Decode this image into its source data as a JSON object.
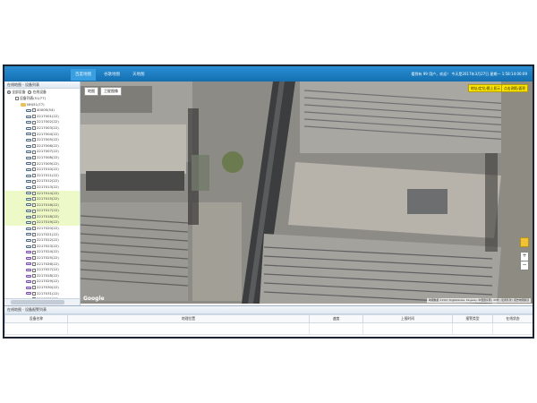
{
  "nav": {
    "tabs": [
      {
        "label": "百度地图"
      },
      {
        "label": "谷歌地图"
      },
      {
        "label": "天地图"
      }
    ]
  },
  "user": {
    "text": "看到有 99 用户，欢迎！    今天是2017年3月27日 星期一  1:58:14:00:09"
  },
  "sidebar": {
    "title": "在线地图 - 设备列表",
    "options": [
      {
        "label": "全部设备",
        "checked": true
      },
      {
        "label": "在线设备",
        "checked": false
      }
    ],
    "tree": [
      {
        "label": "设备列表(51/77)",
        "kind": "root"
      },
      {
        "label": "NH(51/77)",
        "kind": "folder"
      },
      {
        "label": "40000(54)",
        "kind": "device",
        "status": "online"
      },
      {
        "label": "2217001(22)",
        "kind": "device",
        "status": "online"
      },
      {
        "label": "2217002(22)",
        "kind": "device",
        "status": "online"
      },
      {
        "label": "2217003(22)",
        "kind": "device",
        "status": "online"
      },
      {
        "label": "2217004(22)",
        "kind": "device",
        "status": "online"
      },
      {
        "label": "2217005(22)",
        "kind": "device",
        "status": "online"
      },
      {
        "label": "2217006(22)",
        "kind": "device",
        "status": "online"
      },
      {
        "label": "2217007(22)",
        "kind": "device",
        "status": "online"
      },
      {
        "label": "2217008(22)",
        "kind": "device",
        "status": "online"
      },
      {
        "label": "2217009(22)",
        "kind": "device",
        "status": "online"
      },
      {
        "label": "2217010(22)",
        "kind": "device",
        "status": "online"
      },
      {
        "label": "2217011(22)",
        "kind": "device",
        "status": "online"
      },
      {
        "label": "2217012(22)",
        "kind": "device",
        "status": "online"
      },
      {
        "label": "2217013(22)",
        "kind": "device",
        "status": "online"
      },
      {
        "label": "2217014(22)",
        "kind": "device",
        "status": "selected"
      },
      {
        "label": "2217015(22)",
        "kind": "device",
        "status": "selected"
      },
      {
        "label": "2217016(22)",
        "kind": "device",
        "status": "selected"
      },
      {
        "label": "2217017(22)",
        "kind": "device",
        "status": "selected"
      },
      {
        "label": "2217018(22)",
        "kind": "device",
        "status": "selected"
      },
      {
        "label": "2217019(22)",
        "kind": "device",
        "status": "selected"
      },
      {
        "label": "2217020(22)",
        "kind": "device",
        "status": "online"
      },
      {
        "label": "2217021(22)",
        "kind": "device",
        "status": "online"
      },
      {
        "label": "2217022(22)",
        "kind": "device",
        "status": "online"
      },
      {
        "label": "2217023(22)",
        "kind": "device",
        "status": "online"
      },
      {
        "label": "2217024(22)",
        "kind": "device",
        "status": "purple"
      },
      {
        "label": "2217025(22)",
        "kind": "device",
        "status": "purple"
      },
      {
        "label": "2217026(22)",
        "kind": "device",
        "status": "purple"
      },
      {
        "label": "2217027(22)",
        "kind": "device",
        "status": "purple"
      },
      {
        "label": "2217028(22)",
        "kind": "device",
        "status": "purple"
      },
      {
        "label": "2217029(22)",
        "kind": "device",
        "status": "purple"
      },
      {
        "label": "2217030(22)",
        "kind": "device",
        "status": "purple"
      },
      {
        "label": "2217031(22)",
        "kind": "device",
        "status": "purple"
      },
      {
        "label": "2217032(22)",
        "kind": "device",
        "status": "purple"
      }
    ]
  },
  "map": {
    "type_buttons": [
      {
        "label": "地图"
      },
      {
        "label": "卫星图像"
      }
    ],
    "action_buttons": [
      {
        "label": "地址/定位/图上显示"
      },
      {
        "label": "点击测距/面积"
      }
    ],
    "brand": "Google",
    "copyright": "地图数据 ©2017 DigitalGlobe, Kingway, 中国国家图 | 20米 | 使用条款 | 报告地图错误"
  },
  "bottom": {
    "title": "在线地图 - 设备报警列表",
    "columns": [
      {
        "label": "设备名称"
      },
      {
        "label": "地理位置"
      },
      {
        "label": "速度"
      },
      {
        "label": "上报时间"
      },
      {
        "label": "报警类型"
      },
      {
        "label": "在线状态"
      }
    ]
  },
  "colors": {
    "topbar": "#1b78bd",
    "selected_row": "#eef9c8",
    "action_button": "#ffe600",
    "offline_car": "#7b4fb3"
  }
}
